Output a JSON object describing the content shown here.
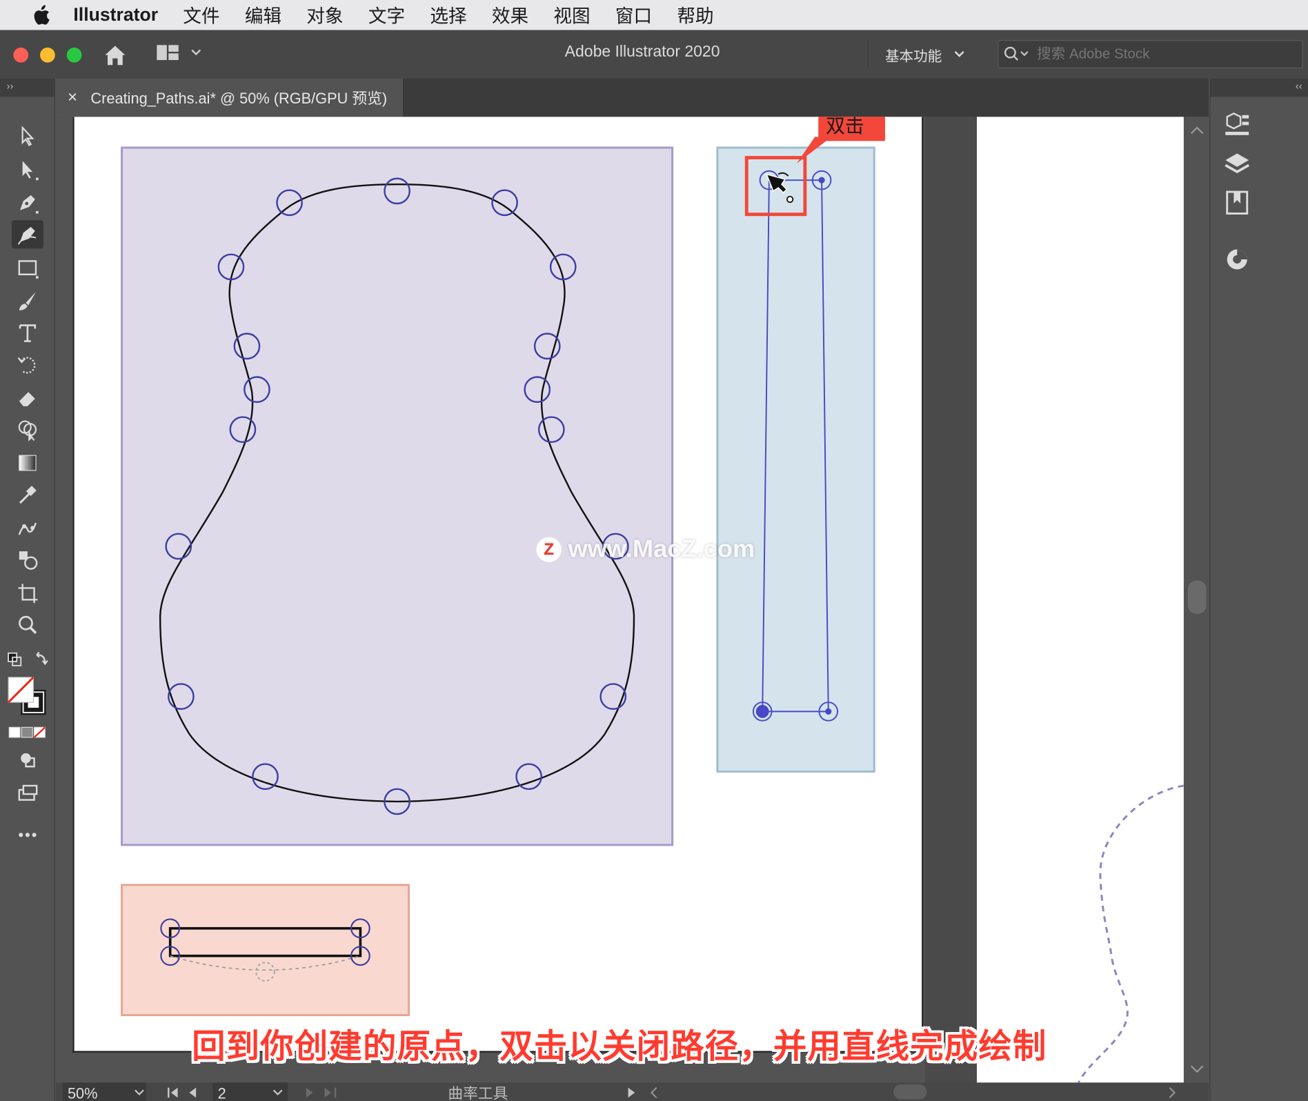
{
  "menubar": {
    "app_name": "Illustrator",
    "items": [
      "文件",
      "编辑",
      "对象",
      "文字",
      "选择",
      "效果",
      "视图",
      "窗口",
      "帮助"
    ]
  },
  "appbar": {
    "title": "Adobe Illustrator 2020",
    "workspace": "基本功能",
    "search_placeholder": "搜索 Adobe Stock"
  },
  "document": {
    "tab_title": "Creating_Paths.ai* @ 50% (RGB/GPU 预览)",
    "close_glyph": "×"
  },
  "callout": {
    "label": "双击"
  },
  "caption": "回到你创建的原点，双击以关闭路径，并用直线完成绘制",
  "watermark": "www.MacZ.com",
  "statusbar": {
    "zoom": "50%",
    "page": "2",
    "tool_name": "曲率工具"
  },
  "colors": {
    "guitar_panel_fill": "#dfdaea",
    "guitar_panel_border": "#a79bc6",
    "neck_panel_fill": "#d5e4ec",
    "neck_panel_border": "#9fbdd0",
    "bridge_panel_fill": "#f9d9cf",
    "bridge_panel_border": "#e8a592",
    "anchor_color": "#3e3ea0",
    "callout_red": "#f2473a"
  },
  "toolbar_tools": [
    "selection-tool",
    "direct-selection-tool",
    "pen-tool",
    "curvature-tool",
    "rectangle-tool",
    "paintbrush-tool",
    "type-tool",
    "rotate-tool",
    "eraser-tool",
    "shape-builder-tool",
    "gradient-tool",
    "eyedropper-tool",
    "puppet-warp-tool",
    "symbol-sprayer-tool",
    "artboard-tool",
    "zoom-tool",
    "swap-fill-stroke",
    "fill-stroke-swatch",
    "color-modes",
    "draw-mode",
    "screen-mode",
    "more-tools"
  ],
  "right_panel_icons": [
    "properties-icon",
    "layers-icon",
    "libraries-icon",
    "color-guide-icon"
  ]
}
